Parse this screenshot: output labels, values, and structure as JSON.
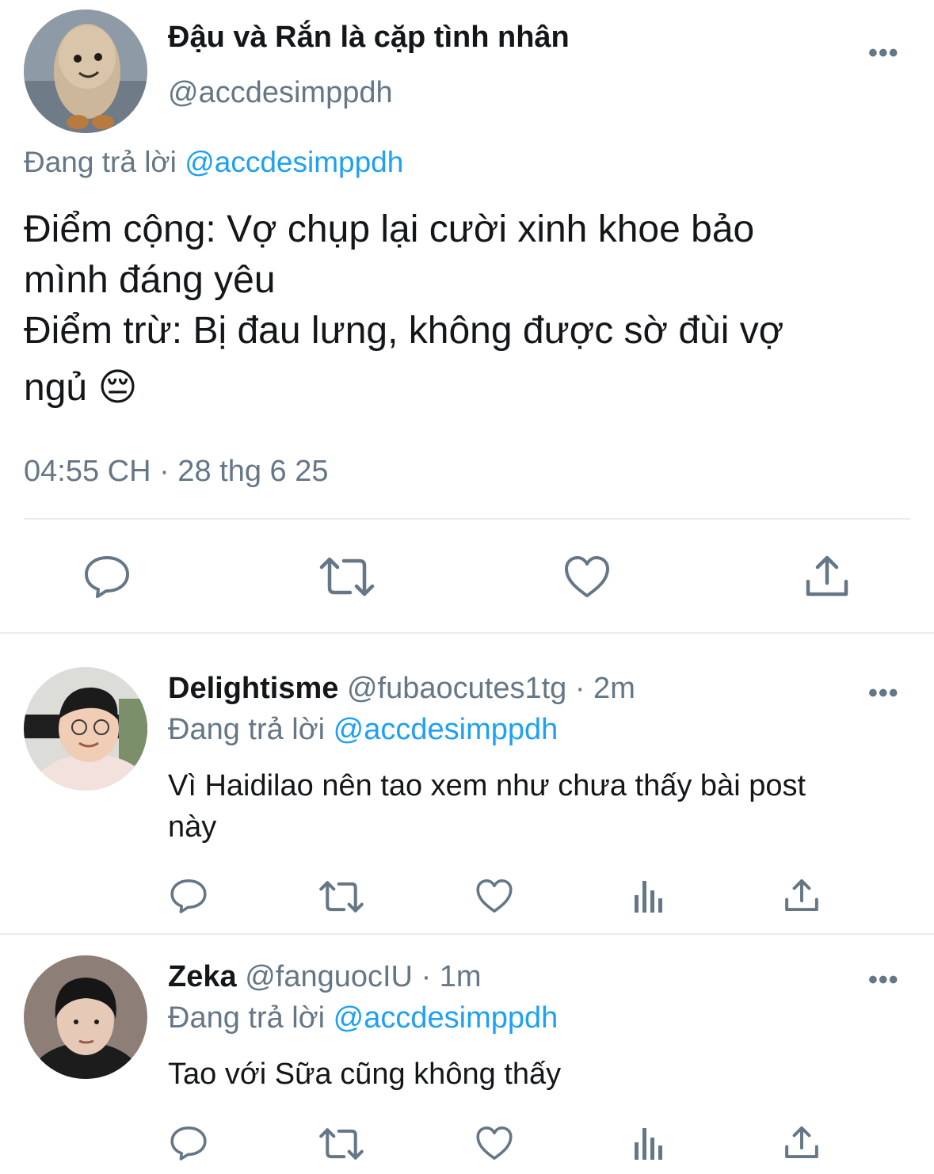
{
  "main_tweet": {
    "display_name": "Đậu và Rắn là cặp tình nhân",
    "handle": "@accdesimppdh",
    "replying_prefix": "Đang trả lời",
    "replying_to": "@accdesimppdh",
    "text_line1": "Điểm cộng: Vợ chụp lại cười xinh khoe bảo",
    "text_line2": "mình đáng yêu",
    "text_line3": "Điểm trừ: Bị đau lưng, không được sờ đùi vợ",
    "text_line4": "ngủ",
    "emoji": "😔",
    "timestamp": "04:55 CH · 28 thg 6 25",
    "more_label": "•••"
  },
  "replies": [
    {
      "display_name": "Delightisme",
      "handle": "@fubaocutes1tg",
      "time": "· 2m",
      "replying_prefix": "Đang trả lời",
      "replying_to": "@accdesimppdh",
      "text_line1": "Vì Haidilao nên tao xem như chưa thấy bài post",
      "text_line2": "này",
      "more_label": "•••"
    },
    {
      "display_name": "Zeka",
      "handle": "@fanguocIU",
      "time": "· 1m",
      "replying_prefix": "Đang trả lời",
      "replying_to": "@accdesimppdh",
      "text_line1": "Tao với Sữa cũng không thấy",
      "more_label": "•••"
    }
  ],
  "icons": {
    "reply": "reply-icon",
    "retweet": "retweet-icon",
    "like": "heart-icon",
    "share": "share-icon",
    "views": "analytics-icon",
    "more": "more-icon"
  },
  "colors": {
    "link": "#1da1f2",
    "muted": "#657786",
    "text": "#14171a",
    "divider": "#e6ecf0"
  }
}
